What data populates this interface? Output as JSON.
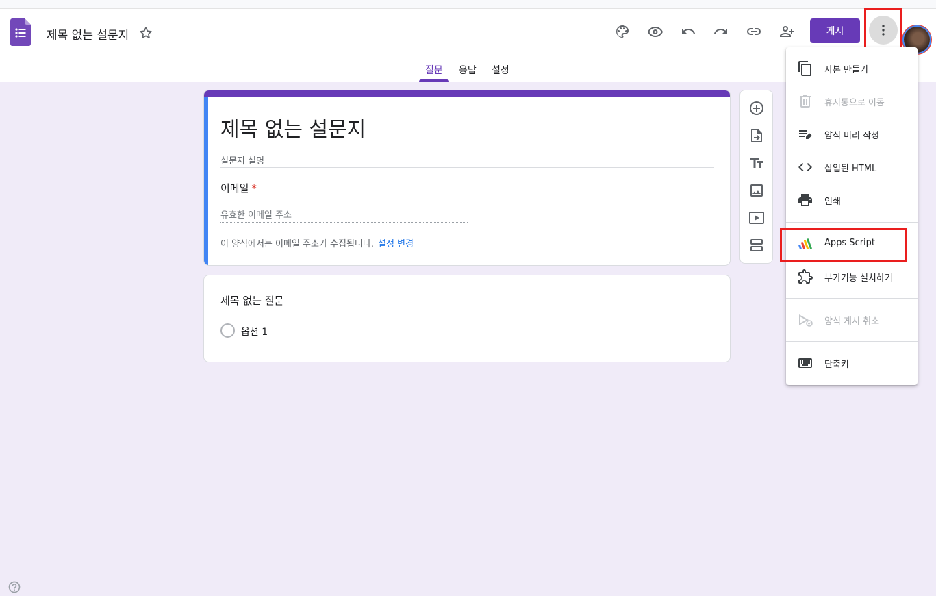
{
  "header": {
    "doc_title": "제목 없는 설문지",
    "publish_label": "게시",
    "tabs": [
      {
        "label": "질문"
      },
      {
        "label": "응답"
      },
      {
        "label": "설정"
      }
    ],
    "toolbar_icons": [
      "palette-icon",
      "preview-icon",
      "undo-icon",
      "redo-icon",
      "link-icon",
      "add-collaborator-icon",
      "more-vert-icon"
    ]
  },
  "form": {
    "title": "제목 없는 설문지",
    "description_placeholder": "설문지 설명",
    "email_label": "이메일",
    "required_mark": "*",
    "email_placeholder": "유효한 이메일 주소",
    "collect_text": "이 양식에서는 이메일 주소가 수집됩니다.",
    "collect_link": "설정 변경"
  },
  "question": {
    "title": "제목 없는 질문",
    "options": [
      {
        "label": "옵션 1"
      }
    ]
  },
  "side_toolbar": [
    "add-question-icon",
    "import-questions-icon",
    "add-title-icon",
    "add-image-icon",
    "add-video-icon",
    "add-section-icon"
  ],
  "menu": {
    "items": [
      {
        "label": "사본 만들기",
        "icon": "copy-icon",
        "enabled": true
      },
      {
        "label": "휴지통으로 이동",
        "icon": "trash-icon",
        "enabled": false
      },
      {
        "label": "양식 미리 작성",
        "icon": "prefill-icon",
        "enabled": true
      },
      {
        "label": "삽입된 HTML",
        "icon": "code-icon",
        "enabled": true
      },
      {
        "label": "인쇄",
        "icon": "print-icon",
        "enabled": true
      },
      {
        "label": "Apps Script",
        "icon": "apps-script-icon",
        "enabled": true
      },
      {
        "label": "부가기능 설치하기",
        "icon": "addon-icon",
        "enabled": true
      },
      {
        "label": "양식 게시 취소",
        "icon": "unpublish-icon",
        "enabled": false
      },
      {
        "label": "단축키",
        "icon": "keyboard-icon",
        "enabled": true
      }
    ]
  },
  "colors": {
    "brand": "#673ab7",
    "accent_blue": "#4285f4",
    "link": "#1a73e8",
    "highlight": "#ea1e1e",
    "background": "#f0ebf8"
  }
}
